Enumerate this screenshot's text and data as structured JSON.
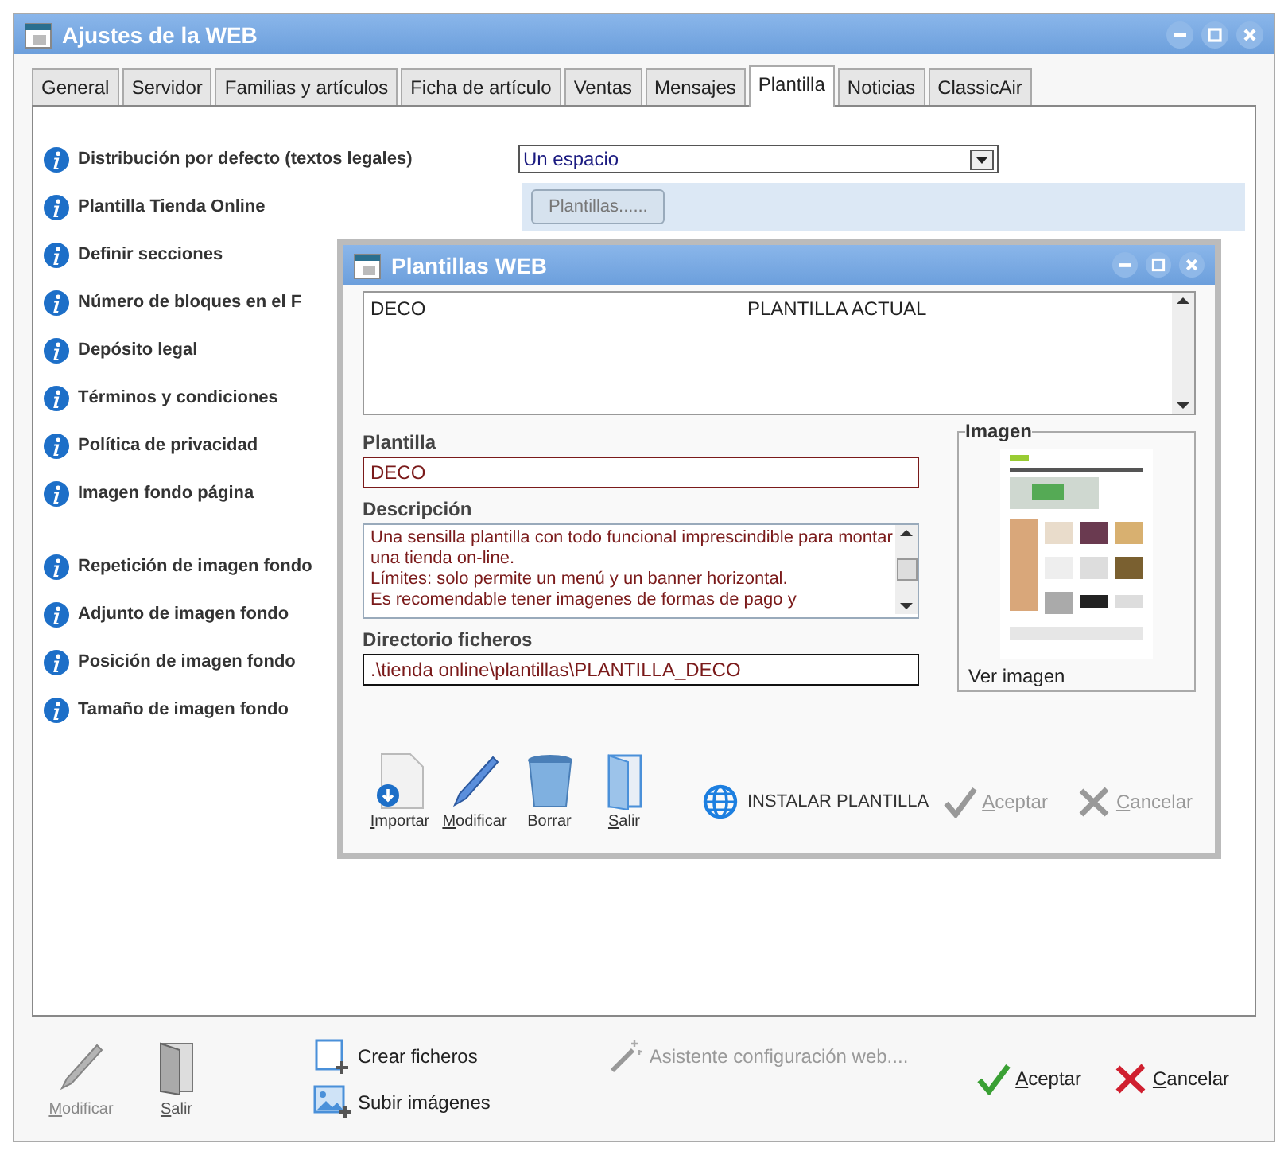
{
  "window": {
    "title": "Ajustes de la WEB"
  },
  "tabs": [
    {
      "label": "General",
      "selected": false
    },
    {
      "label": "Servidor",
      "selected": false
    },
    {
      "label": "Familias y artículos",
      "selected": false
    },
    {
      "label": "Ficha de artículo",
      "selected": false
    },
    {
      "label": "Ventas",
      "selected": false
    },
    {
      "label": "Mensajes",
      "selected": false
    },
    {
      "label": "Plantilla",
      "selected": true
    },
    {
      "label": "Noticias",
      "selected": false
    },
    {
      "label": "ClassicAir",
      "selected": false
    }
  ],
  "settings": [
    {
      "label": "Distribución por defecto (textos legales)",
      "kind": "select",
      "value": "Un espacio"
    },
    {
      "label": "Plantilla Tienda Online",
      "kind": "button",
      "value": "Plantillas......"
    },
    {
      "label": "Definir secciones",
      "kind": "none"
    },
    {
      "label": "Número de bloques en el F",
      "kind": "none"
    },
    {
      "label": "Depósito legal",
      "kind": "none"
    },
    {
      "label": "Términos y condiciones",
      "kind": "none"
    },
    {
      "label": "Política de privacidad",
      "kind": "none"
    },
    {
      "label": "Imagen fondo página",
      "kind": "none"
    }
  ],
  "background_settings": [
    {
      "label": "Repetición de imagen fondo"
    },
    {
      "label": "Adjunto de imagen fondo"
    },
    {
      "label": "Posición de imagen fondo"
    },
    {
      "label": "Tamaño de imagen fondo"
    }
  ],
  "toolbar": [
    {
      "label": "Modificar",
      "kind": "pen",
      "disabled": true
    },
    {
      "label": "Salir",
      "kind": "door",
      "disabled": false
    }
  ],
  "file_actions": [
    {
      "label": "Crear ficheros",
      "kind": "new-file"
    },
    {
      "label": "Subir imágenes",
      "kind": "image"
    }
  ],
  "wizard": {
    "label": "Asistente configuración web....",
    "disabled": true
  },
  "actions": [
    {
      "label": "Aceptar",
      "kind": "ok"
    },
    {
      "label": "Cancelar",
      "kind": "cancel"
    }
  ],
  "dialog": {
    "title": "Plantillas WEB",
    "list_rows": [
      {
        "name": "DECO",
        "status": "PLANTILLA ACTUAL"
      }
    ],
    "template_label": "Plantilla",
    "template_value": "DECO",
    "description_label": "Descripción",
    "description_lines": [
      "Una sensilla plantilla con todo funcional imprescindible para montar",
      "una tienda on-line.",
      "Límites: solo permite un menú y un banner horizontal.",
      "Es recomendable tener imagenes de formas de pago y"
    ],
    "directory_label": "Directorio ficheros",
    "directory_value": ".\\tienda online\\plantillas\\PLANTILLA_DECO",
    "image_label": "Imagen",
    "image_link": "Ver imagen",
    "tools": [
      {
        "label": "Importar",
        "kind": "import",
        "mnemonic": true
      },
      {
        "label": "Modificar",
        "kind": "pen",
        "mnemonic": true
      },
      {
        "label": "Borrar",
        "kind": "trash",
        "mnemonic": false
      },
      {
        "label": "Salir",
        "kind": "door",
        "mnemonic": true
      }
    ],
    "install": "INSTALAR PLANTILLA",
    "actions": [
      {
        "label": "Aceptar",
        "kind": "ok",
        "disabled": true
      },
      {
        "label": "Cancelar",
        "kind": "cancel",
        "disabled": true
      }
    ]
  }
}
